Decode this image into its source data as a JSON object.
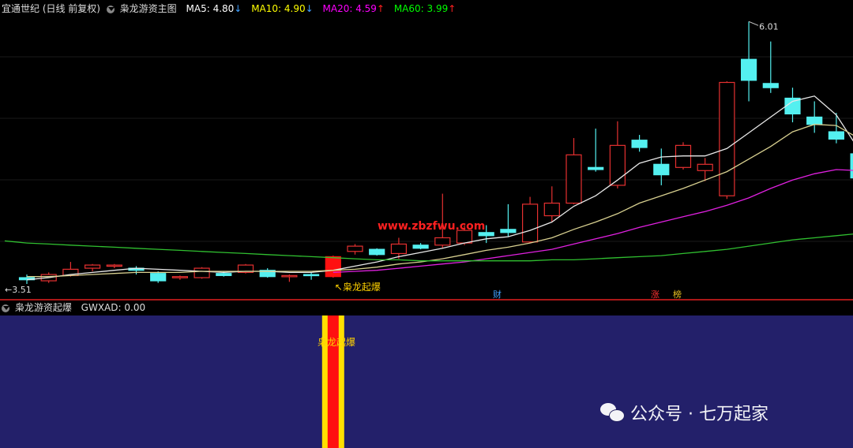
{
  "header": {
    "app_title": "宜通世纪 (日线 前复权)",
    "indicator_name": "枭龙游资主图",
    "ma": [
      {
        "label": "MA5:",
        "value": "4.80",
        "arrow": "↓",
        "color": "#ffffff"
      },
      {
        "label": "MA10:",
        "value": "4.90",
        "arrow": "↓",
        "color": "#ffff00"
      },
      {
        "label": "MA20:",
        "value": "4.59",
        "arrow": "↑",
        "color": "#ff00ff"
      },
      {
        "label": "MA60:",
        "value": "3.99",
        "arrow": "↑",
        "color": "#00ff00"
      }
    ],
    "arrow_colors": {
      "up": "#ff2020",
      "down": "#40a0ff"
    }
  },
  "sub_panel": {
    "indicator_name": "枭龙游资起爆",
    "value_label": "GWXAD: 0.00",
    "signal_label": "枭龙起爆",
    "background": "#23206a"
  },
  "markers": {
    "signal_text": "↖枭龙起爆",
    "high_label": "6.01",
    "low_label": "3.51",
    "event_cai": "财",
    "event_zhang": "涨",
    "event_pan": "榜"
  },
  "watermark": {
    "site": "www.zbzfwu.com",
    "account": "公众号 · 七万起家"
  },
  "chart_data": {
    "type": "candlestick",
    "price_range": [
      3.45,
      6.05
    ],
    "candles": [
      {
        "o": 3.57,
        "h": 3.6,
        "l": 3.51,
        "c": 3.55
      },
      {
        "o": 3.54,
        "h": 3.62,
        "l": 3.52,
        "c": 3.6
      },
      {
        "o": 3.59,
        "h": 3.72,
        "l": 3.58,
        "c": 3.65
      },
      {
        "o": 3.66,
        "h": 3.7,
        "l": 3.63,
        "c": 3.69
      },
      {
        "o": 3.68,
        "h": 3.7,
        "l": 3.66,
        "c": 3.69
      },
      {
        "o": 3.66,
        "h": 3.68,
        "l": 3.6,
        "c": 3.64
      },
      {
        "o": 3.61,
        "h": 3.63,
        "l": 3.52,
        "c": 3.54
      },
      {
        "o": 3.57,
        "h": 3.59,
        "l": 3.55,
        "c": 3.58
      },
      {
        "o": 3.57,
        "h": 3.67,
        "l": 3.56,
        "c": 3.66
      },
      {
        "o": 3.61,
        "h": 3.63,
        "l": 3.58,
        "c": 3.59
      },
      {
        "o": 3.62,
        "h": 3.7,
        "l": 3.61,
        "c": 3.69
      },
      {
        "o": 3.64,
        "h": 3.66,
        "l": 3.57,
        "c": 3.58
      },
      {
        "o": 3.58,
        "h": 3.6,
        "l": 3.53,
        "c": 3.59
      },
      {
        "o": 3.6,
        "h": 3.62,
        "l": 3.55,
        "c": 3.59
      },
      {
        "o": 3.58,
        "h": 3.78,
        "l": 3.57,
        "c": 3.77
      },
      {
        "o": 3.82,
        "h": 3.89,
        "l": 3.79,
        "c": 3.87
      },
      {
        "o": 3.84,
        "h": 3.85,
        "l": 3.78,
        "c": 3.79
      },
      {
        "o": 3.8,
        "h": 3.95,
        "l": 3.75,
        "c": 3.89
      },
      {
        "o": 3.88,
        "h": 3.9,
        "l": 3.84,
        "c": 3.85
      },
      {
        "o": 3.88,
        "h": 4.37,
        "l": 3.85,
        "c": 3.95
      },
      {
        "o": 3.9,
        "h": 4.07,
        "l": 3.88,
        "c": 4.02
      },
      {
        "o": 4.0,
        "h": 4.07,
        "l": 3.9,
        "c": 3.97
      },
      {
        "o": 4.03,
        "h": 4.27,
        "l": 3.96,
        "c": 4.0
      },
      {
        "o": 3.91,
        "h": 4.34,
        "l": 3.9,
        "c": 4.27
      },
      {
        "o": 4.16,
        "h": 4.44,
        "l": 4.1,
        "c": 4.28
      },
      {
        "o": 4.28,
        "h": 4.9,
        "l": 4.27,
        "c": 4.74
      },
      {
        "o": 4.62,
        "h": 4.99,
        "l": 4.58,
        "c": 4.6
      },
      {
        "o": 4.45,
        "h": 5.06,
        "l": 4.42,
        "c": 4.83
      },
      {
        "o": 4.88,
        "h": 4.93,
        "l": 4.77,
        "c": 4.81
      },
      {
        "o": 4.65,
        "h": 4.8,
        "l": 4.45,
        "c": 4.55
      },
      {
        "o": 4.62,
        "h": 4.86,
        "l": 4.6,
        "c": 4.83
      },
      {
        "o": 4.59,
        "h": 4.71,
        "l": 4.49,
        "c": 4.65
      },
      {
        "o": 4.35,
        "h": 5.44,
        "l": 4.32,
        "c": 5.43
      },
      {
        "o": 5.65,
        "h": 6.01,
        "l": 5.25,
        "c": 5.45
      },
      {
        "o": 5.42,
        "h": 5.82,
        "l": 5.33,
        "c": 5.38
      },
      {
        "o": 5.28,
        "h": 5.38,
        "l": 5.05,
        "c": 5.13
      },
      {
        "o": 5.1,
        "h": 5.25,
        "l": 4.95,
        "c": 5.03
      },
      {
        "o": 4.96,
        "h": 5.14,
        "l": 4.85,
        "c": 4.89
      },
      {
        "o": 4.75,
        "h": 4.76,
        "l": 4.5,
        "c": 4.52
      }
    ],
    "ma_lines": [
      {
        "name": "MA5",
        "color": "#e8e8e8",
        "values": [
          3.55,
          3.57,
          3.6,
          3.62,
          3.64,
          3.66,
          3.65,
          3.64,
          3.63,
          3.62,
          3.63,
          3.63,
          3.62,
          3.62,
          3.64,
          3.68,
          3.72,
          3.77,
          3.81,
          3.85,
          3.9,
          3.94,
          3.96,
          4.02,
          4.1,
          4.25,
          4.35,
          4.5,
          4.66,
          4.72,
          4.73,
          4.73,
          4.8,
          4.95,
          5.1,
          5.25,
          5.3,
          5.12,
          4.8
        ]
      },
      {
        "name": "MA10",
        "color": "#d8d090",
        "values": [
          3.58,
          3.58,
          3.59,
          3.6,
          3.61,
          3.62,
          3.62,
          3.62,
          3.63,
          3.63,
          3.63,
          3.63,
          3.63,
          3.63,
          3.64,
          3.65,
          3.67,
          3.7,
          3.72,
          3.75,
          3.79,
          3.83,
          3.86,
          3.9,
          3.95,
          4.03,
          4.1,
          4.18,
          4.28,
          4.35,
          4.42,
          4.5,
          4.58,
          4.7,
          4.82,
          4.96,
          5.03,
          5.02,
          4.9
        ]
      },
      {
        "name": "MA20",
        "color": "#e020e0",
        "values": [
          null,
          null,
          null,
          null,
          null,
          null,
          null,
          null,
          null,
          null,
          null,
          null,
          null,
          null,
          3.62,
          3.63,
          3.64,
          3.66,
          3.68,
          3.7,
          3.72,
          3.75,
          3.78,
          3.81,
          3.84,
          3.89,
          3.94,
          3.99,
          4.05,
          4.1,
          4.15,
          4.2,
          4.26,
          4.33,
          4.42,
          4.5,
          4.56,
          4.6,
          4.59
        ]
      },
      {
        "name": "MA60",
        "color": "#30c030",
        "values": [
          3.9,
          3.89,
          3.88,
          3.87,
          3.86,
          3.85,
          3.84,
          3.83,
          3.82,
          3.81,
          3.8,
          3.79,
          3.78,
          3.77,
          3.76,
          3.75,
          3.74,
          3.74,
          3.73,
          3.73,
          3.73,
          3.73,
          3.73,
          3.73,
          3.74,
          3.74,
          3.75,
          3.76,
          3.77,
          3.78,
          3.8,
          3.82,
          3.84,
          3.87,
          3.9,
          3.93,
          3.95,
          3.97,
          3.99
        ]
      }
    ],
    "signal_index": 14
  }
}
